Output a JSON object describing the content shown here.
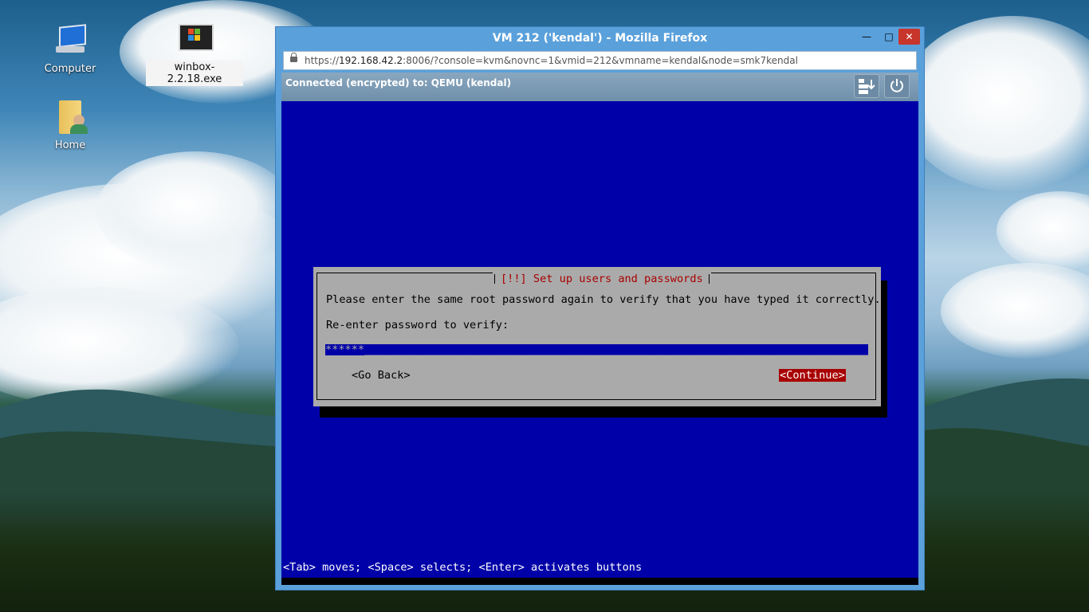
{
  "desktop": {
    "icons": [
      {
        "label": "Computer",
        "icon": "computer-icon"
      },
      {
        "label": "winbox-2.2.18.exe",
        "icon": "windows-exe-icon"
      },
      {
        "label": "Home",
        "icon": "home-folder-icon"
      }
    ]
  },
  "window": {
    "title": "VM 212 ('kendal') - Mozilla Firefox",
    "url_prefix": "https://",
    "url_host": "192.168.42.2",
    "url_rest": ":8006/?console=kvm&novnc=1&vmid=212&vmname=kendal&node=smk7kendal",
    "minimize": "—",
    "maximize": "□",
    "close": "✕"
  },
  "novnc": {
    "status": "Connected (encrypted) to: QEMU (kendal)",
    "settings_icon": "send-keys-icon",
    "power_icon": "power-icon"
  },
  "installer": {
    "dialog_title": "[!!] Set up users and passwords",
    "message": "Please enter the same root password again to verify that you have typed it correctly.",
    "prompt": "Re-enter password to verify:",
    "password_value": "******",
    "go_back": "<Go Back>",
    "continue": "<Continue>",
    "help": "<Tab> moves; <Space> selects; <Enter> activates buttons"
  },
  "colors": {
    "console_bg": "#0000a8",
    "dialog_bg": "#aaaaaa",
    "accent_red": "#a80000",
    "titlebar": "#5aa0db"
  }
}
